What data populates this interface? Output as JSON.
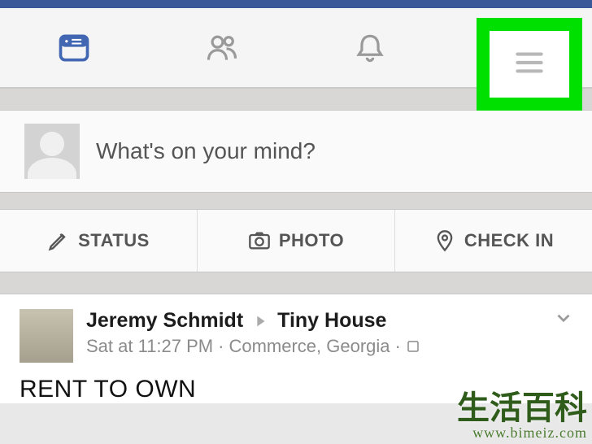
{
  "composer": {
    "placeholder": "What's on your mind?"
  },
  "actions": {
    "status": "STATUS",
    "photo": "PHOTO",
    "checkin": "CHECK IN"
  },
  "post": {
    "author": "Jeremy Schmidt",
    "target": "Tiny House",
    "timestamp": "Sat at 11:27 PM",
    "separator": "·",
    "location": "Commerce, Georgia",
    "body": "RENT TO OWN"
  },
  "watermark": {
    "line1": "生活百科",
    "line2": "www.bimeiz.com"
  }
}
